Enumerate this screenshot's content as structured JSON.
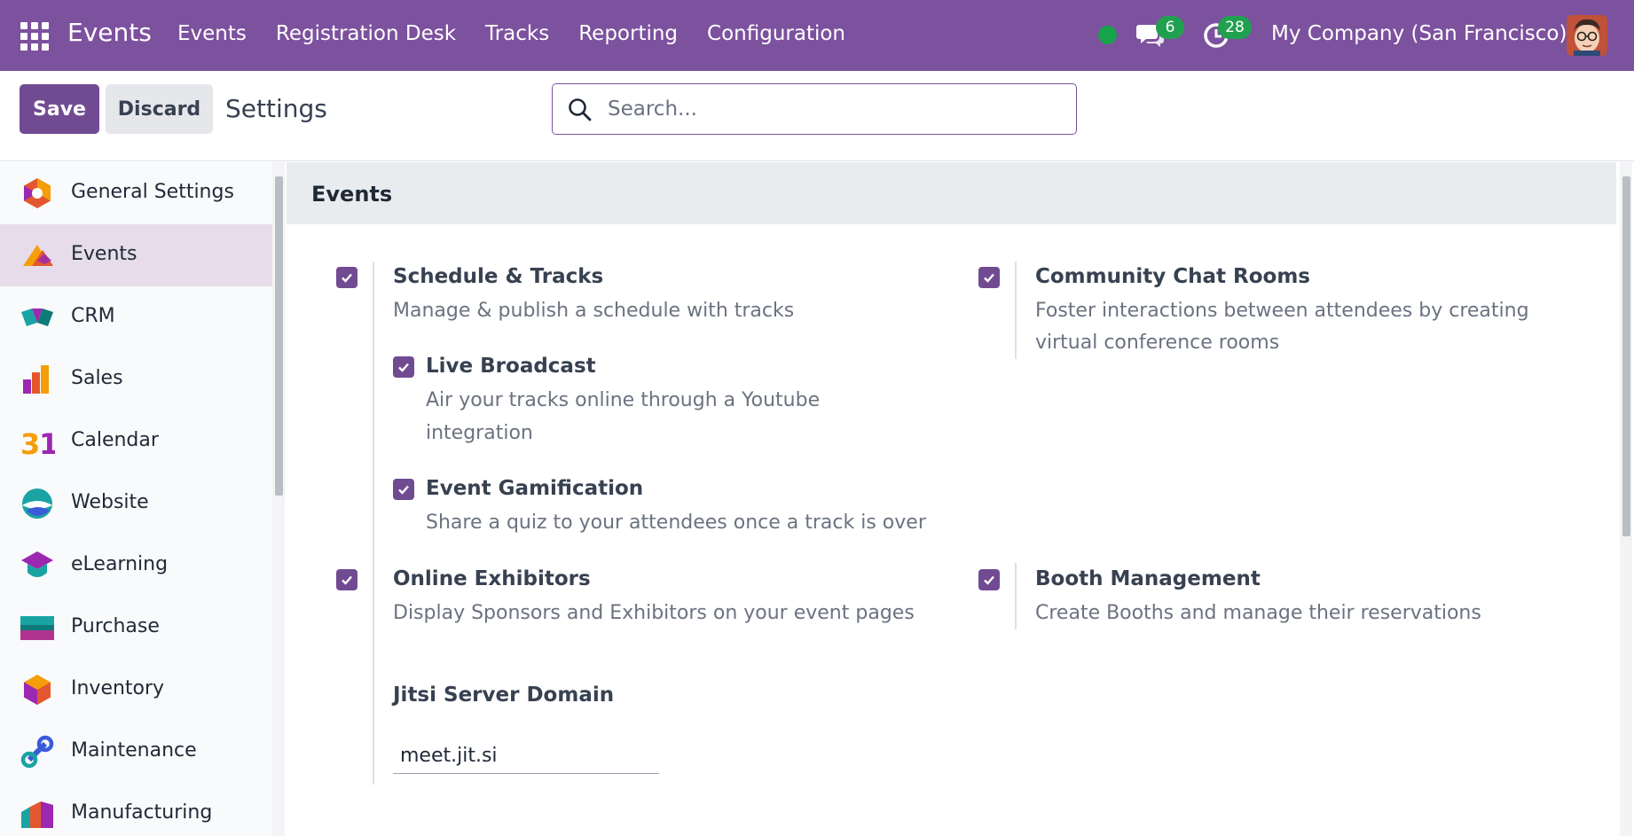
{
  "navbar": {
    "brand": "Events",
    "menu": [
      "Events",
      "Registration Desk",
      "Tracks",
      "Reporting",
      "Configuration"
    ],
    "chat_count": "6",
    "activity_count": "28",
    "company": "My Company (San Francisco)"
  },
  "control": {
    "save_label": "Save",
    "discard_label": "Discard",
    "title": "Settings",
    "search_placeholder": "Search..."
  },
  "sidebar": {
    "items": [
      {
        "label": "General Settings",
        "icon": "general-settings-icon"
      },
      {
        "label": "Events",
        "icon": "events-app-icon"
      },
      {
        "label": "CRM",
        "icon": "crm-icon"
      },
      {
        "label": "Sales",
        "icon": "sales-icon"
      },
      {
        "label": "Calendar",
        "icon": "calendar-icon"
      },
      {
        "label": "Website",
        "icon": "website-icon"
      },
      {
        "label": "eLearning",
        "icon": "elearning-icon"
      },
      {
        "label": "Purchase",
        "icon": "purchase-icon"
      },
      {
        "label": "Inventory",
        "icon": "inventory-icon"
      },
      {
        "label": "Maintenance",
        "icon": "maintenance-icon"
      },
      {
        "label": "Manufacturing",
        "icon": "manufacturing-icon"
      }
    ],
    "active": "Events"
  },
  "section": {
    "title": "Events",
    "settings": {
      "schedule_tracks": {
        "title": "Schedule & Tracks",
        "desc": "Manage & publish a schedule with tracks",
        "checked": true
      },
      "live_broadcast": {
        "title": "Live Broadcast",
        "desc_1": "Air your tracks online through a Youtube",
        "desc_2": "integration",
        "checked": true
      },
      "event_gamification": {
        "title": "Event Gamification",
        "desc": "Share a quiz to your attendees once a track is over",
        "checked": true
      },
      "community_chat": {
        "title": "Community Chat Rooms",
        "desc_1": "Foster interactions between attendees by creating",
        "desc_2": "virtual conference rooms",
        "checked": true
      },
      "online_exhibitors": {
        "title": "Online Exhibitors",
        "desc": "Display Sponsors and Exhibitors on your event pages",
        "checked": true
      },
      "booth_management": {
        "title": "Booth Management",
        "desc": "Create Booths and manage their reservations",
        "checked": true
      },
      "jitsi": {
        "title": "Jitsi Server Domain",
        "value": "meet.jit.si"
      }
    }
  },
  "colors": {
    "navbar": "#7c519e",
    "primary": "#714b92",
    "badge": "#21a150",
    "active_item": "#e6dcea"
  }
}
